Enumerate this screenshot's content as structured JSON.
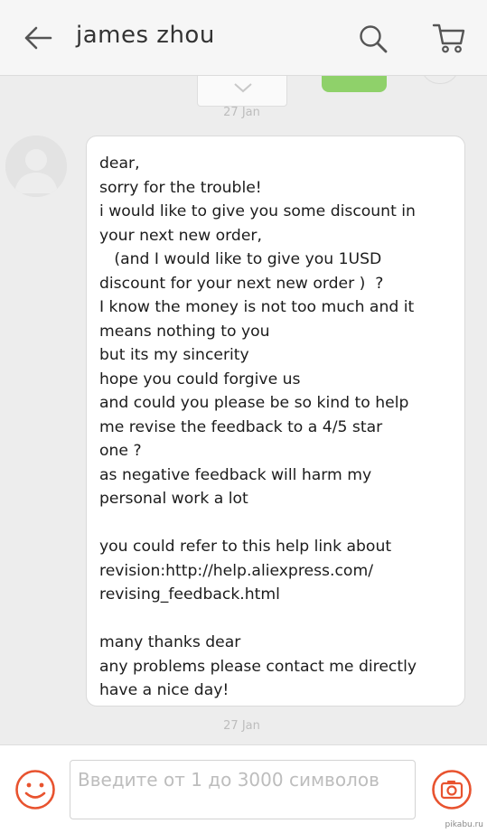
{
  "header": {
    "title": "james zhou",
    "back_icon": "arrow-left-icon",
    "search_icon": "search-icon",
    "cart_icon": "cart-icon"
  },
  "chat": {
    "timestamps": [
      "27 Jan",
      "27 Jan"
    ],
    "message": "dear,\nsorry for the trouble!\ni would like to give you some discount in\nyour next new order,\n   (and I would like to give you 1USD\ndiscount for your next new order )  ?\nI know the money is not too much and it\nmeans nothing to you\nbut its my sincerity\nhope you could forgive us\nand could you please be so kind to help\nme revise the feedback to a 4/5 star\none ?\nas negative feedback will harm my\npersonal work a lot\n\nyou could refer to this help link about\nrevision:http://help.aliexpress.com/\nrevising_feedback.html\n\nmany thanks dear\nany problems please contact me directly\nhave a nice day!"
  },
  "input": {
    "placeholder": "Введите от 1 до 3000 символов",
    "value": ""
  },
  "colors": {
    "accent": "#e8532f",
    "sent_bubble": "#8fd16a",
    "background": "#ededed"
  },
  "watermark": "pikabu.ru"
}
